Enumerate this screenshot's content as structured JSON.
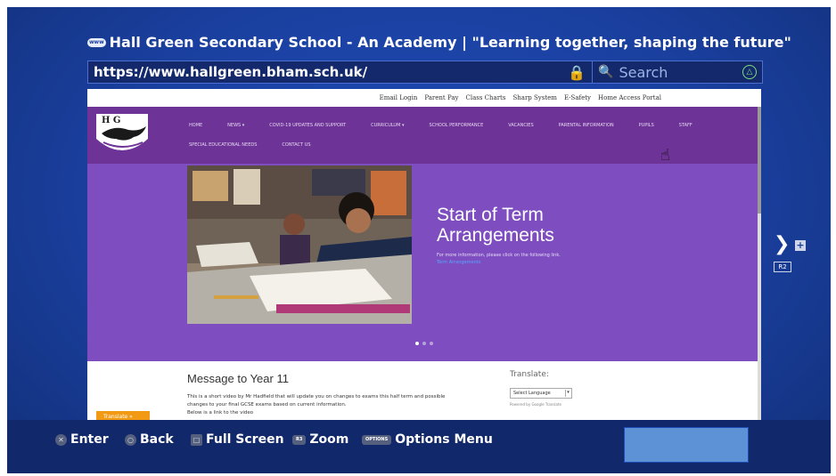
{
  "browser": {
    "title": "Hall Green Secondary School - An Academy | \"Learning together, shaping the future\"",
    "url": "https://www.hallgreen.bham.sch.uk/",
    "search_placeholder": "Search",
    "www_icon_text": "www"
  },
  "page": {
    "top_links": [
      "Email Login",
      "Parent Pay",
      "Class Charts",
      "Sharp System",
      "E-Safety",
      "Home Access Portal"
    ],
    "logo_letters": "H G",
    "nav_row1": [
      "HOME",
      "NEWS ▾",
      "COVID-19 UPDATES AND SUPPORT",
      "CURRICULUM ▾",
      "SCHOOL PERFORMANCE",
      "VACANCIES",
      "PARENTAL INFORMATION",
      "PUPILS",
      "STAFF"
    ],
    "nav_row2": [
      "SPECIAL EDUCATIONAL NEEDS",
      "CONTACT US"
    ],
    "hero": {
      "title_line1": "Start of Term",
      "title_line2": "Arrangements",
      "subtitle": "For more information, please click on the following link.",
      "link_text": "Term Arrangements"
    },
    "message": {
      "title": "Message to Year 11",
      "body_line1": "This is a short video by Mr Hadfield that will update you on changes to exams this half term and possible",
      "body_line2": "changes to your final GCSE exams based on current information.",
      "body_line3": "Below is a link to the video"
    },
    "translate_button": "Translate »",
    "translate_label": "Translate:",
    "language_select": "Select Language",
    "powered_by": "Powered by Google Translate"
  },
  "controls": {
    "enter": "Enter",
    "back": "Back",
    "full_screen": "Full Screen",
    "zoom": "Zoom",
    "zoom_key": "R3",
    "options_key": "OPTIONS",
    "options_menu": "Options Menu",
    "next_key": "R2"
  },
  "colors": {
    "ps_blue": "#1a3f9e",
    "school_purple": "#6d3396",
    "hero_purple": "#7e4ec0",
    "translate_orange": "#f39a14"
  }
}
